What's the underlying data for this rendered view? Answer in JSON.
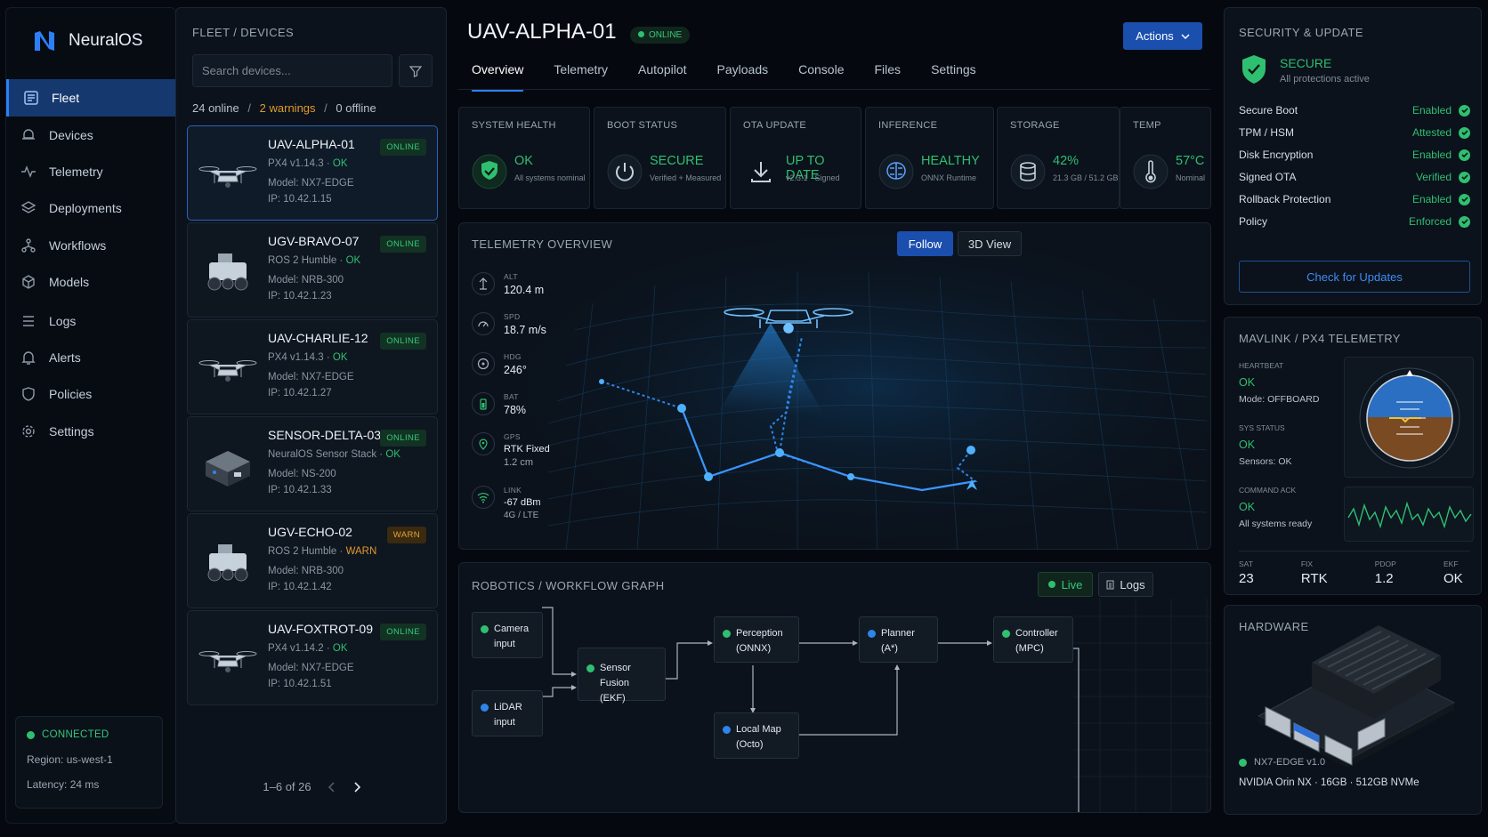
{
  "app": {
    "name": "NeuralOS"
  },
  "nav": {
    "items": [
      {
        "label": "Fleet"
      },
      {
        "label": "Devices"
      },
      {
        "label": "Telemetry"
      },
      {
        "label": "Deployments"
      },
      {
        "label": "Workflows"
      },
      {
        "label": "Models"
      },
      {
        "label": "Logs"
      },
      {
        "label": "Alerts"
      },
      {
        "label": "Policies"
      },
      {
        "label": "Settings"
      }
    ],
    "connection": {
      "status": "CONNECTED",
      "region": "Region: us-west-1",
      "latency": "Latency: 24 ms"
    }
  },
  "fleet": {
    "title": "FLEET / DEVICES",
    "search_placeholder": "Search devices...",
    "counts": {
      "online": "24 online",
      "warnings": "2 warnings",
      "offline": "0 offline",
      "sep": "/"
    },
    "devices": [
      {
        "name": "UAV-ALPHA-01",
        "stack": "PX4 v1.14.3",
        "health": "OK",
        "model": "Model: NX7-EDGE",
        "ip": "IP: 10.42.1.15",
        "status": "ONLINE"
      },
      {
        "name": "UGV-BRAVO-07",
        "stack": "ROS 2 Humble",
        "health": "OK",
        "model": "Model: NRB-300",
        "ip": "IP: 10.42.1.23",
        "status": "ONLINE"
      },
      {
        "name": "UAV-CHARLIE-12",
        "stack": "PX4 v1.14.3",
        "health": "OK",
        "model": "Model: NX7-EDGE",
        "ip": "IP: 10.42.1.27",
        "status": "ONLINE"
      },
      {
        "name": "SENSOR-DELTA-03",
        "stack": "NeuralOS Sensor Stack",
        "health": "OK",
        "model": "Model: NS-200",
        "ip": "IP: 10.42.1.33",
        "status": "ONLINE"
      },
      {
        "name": "UGV-ECHO-02",
        "stack": "ROS 2 Humble",
        "health": "WARN",
        "model": "Model: NRB-300",
        "ip": "IP: 10.42.1.42",
        "status": "WARN"
      },
      {
        "name": "UAV-FOXTROT-09",
        "stack": "PX4 v1.14.2",
        "health": "OK",
        "model": "Model: NX7-EDGE",
        "ip": "IP: 10.42.1.51",
        "status": "ONLINE"
      }
    ],
    "pager": "1–6 of 26"
  },
  "header": {
    "title": "UAV-ALPHA-01",
    "status": "ONLINE",
    "actions_label": "Actions",
    "tabs": [
      "Overview",
      "Telemetry",
      "Autopilot",
      "Payloads",
      "Console",
      "Files",
      "Settings"
    ]
  },
  "tiles": [
    {
      "label": "SYSTEM HEALTH",
      "value": "OK",
      "sub": "All systems nominal",
      "icon": "shield-check-icon"
    },
    {
      "label": "BOOT STATUS",
      "value": "SECURE",
      "sub": "Verified + Measured",
      "icon": "power-icon"
    },
    {
      "label": "OTA UPDATE",
      "value": "UP TO DATE",
      "sub": "v2.3.1 · Signed",
      "icon": "download-icon"
    },
    {
      "label": "INFERENCE",
      "value": "HEALTHY",
      "sub": "ONNX Runtime",
      "icon": "brain-icon"
    },
    {
      "label": "STORAGE",
      "value": "42%",
      "sub": "21.3 GB / 51.2 GB",
      "icon": "database-icon"
    },
    {
      "label": "TEMP",
      "value": "57°C",
      "sub": "Nominal",
      "icon": "thermometer-icon"
    }
  ],
  "telemetry": {
    "title": "TELEMETRY OVERVIEW",
    "follow_label": "Follow",
    "view3d_label": "3D View",
    "metrics": [
      {
        "label": "ALT",
        "value": "120.4 m"
      },
      {
        "label": "SPD",
        "value": "18.7 m/s"
      },
      {
        "label": "HDG",
        "value": "246°"
      },
      {
        "label": "BAT",
        "value": "78%"
      },
      {
        "label": "GPS",
        "value": "RTK Fixed",
        "sub": "1.2 cm"
      },
      {
        "label": "LINK",
        "value": "-67 dBm",
        "sub": "4G / LTE"
      }
    ]
  },
  "workflow": {
    "title": "ROBOTICS / WORKFLOW GRAPH",
    "live_label": "Live",
    "logs_label": "Logs",
    "nodes": [
      {
        "label": "Camera",
        "sub": "input"
      },
      {
        "label": "LiDAR",
        "sub": "input"
      },
      {
        "label": "Sensor Fusion",
        "sub": "(EKF)"
      },
      {
        "label": "Perception",
        "sub": "(ONNX)"
      },
      {
        "label": "Local Map",
        "sub": "(Octo)"
      },
      {
        "label": "Planner",
        "sub": "(A*)"
      },
      {
        "label": "Controller",
        "sub": "(MPC)"
      }
    ]
  },
  "security": {
    "title": "SECURITY & UPDATE",
    "status": "SECURE",
    "status_sub": "All protections active",
    "rows": [
      {
        "label": "Secure Boot",
        "value": "Enabled"
      },
      {
        "label": "TPM / HSM",
        "value": "Attested"
      },
      {
        "label": "Disk Encryption",
        "value": "Enabled"
      },
      {
        "label": "Signed OTA",
        "value": "Verified"
      },
      {
        "label": "Rollback Protection",
        "value": "Enabled"
      },
      {
        "label": "Policy",
        "value": "Enforced"
      }
    ],
    "check_label": "Check for Updates"
  },
  "mavlink": {
    "title": "MAVLINK / PX4 TELEMETRY",
    "items": [
      {
        "label": "HEARTBEAT",
        "value": "OK",
        "sub": "Mode: OFFBOARD"
      },
      {
        "label": "SYS STATUS",
        "value": "OK",
        "sub": "Sensors: OK"
      },
      {
        "label": "COMMAND ACK",
        "value": "OK",
        "sub": "All systems ready"
      }
    ],
    "stats": [
      {
        "label": "SAT",
        "value": "23"
      },
      {
        "label": "FIX",
        "value": "RTK"
      },
      {
        "label": "PDOP",
        "value": "1.2"
      },
      {
        "label": "EKF",
        "value": "OK"
      }
    ]
  },
  "hardware": {
    "title": "HARDWARE",
    "board": "NX7-EDGE v1.0",
    "spec": "NVIDIA Orin NX · 16GB · 512GB NVMe"
  },
  "colors": {
    "accent": "#2d7ff9",
    "ok": "#2fbf71",
    "warn": "#e09a2c",
    "bg": "#05090f",
    "panel": "#0b121b"
  }
}
